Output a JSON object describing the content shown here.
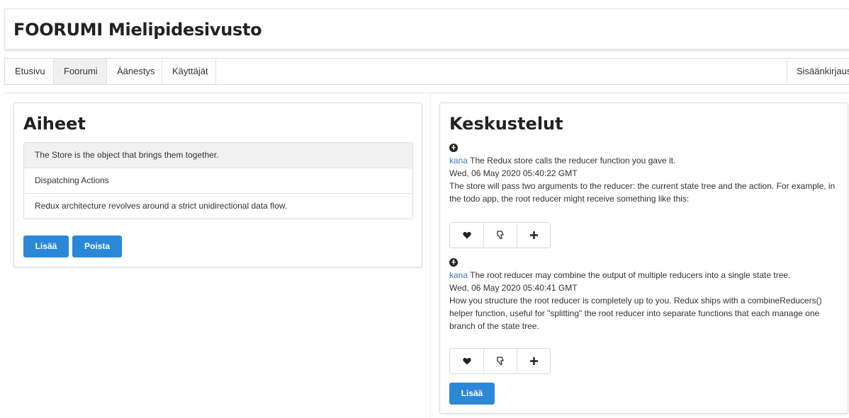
{
  "header": {
    "title": "FOORUMI Mielipidesivusto"
  },
  "nav": {
    "tabs": [
      {
        "label": "Etusivu"
      },
      {
        "label": "Foorumi",
        "active": true
      },
      {
        "label": "Äänestys"
      },
      {
        "label": "Käyttäjät"
      }
    ],
    "login_label": "Sisäänkirjaus"
  },
  "topics": {
    "title": "Aiheet",
    "items": [
      {
        "label": "The Store is the object that brings them together."
      },
      {
        "label": "Dispatching Actions"
      },
      {
        "label": "Redux architecture revolves around a strict unidirectional data flow."
      }
    ],
    "add_label": "Lisää",
    "delete_label": "Poista"
  },
  "discussions": {
    "title": "Keskustelut",
    "posts": [
      {
        "author_icon": "user-circle-icon",
        "author": "kana",
        "subject": " The Redux store calls the reducer function you gave it.",
        "timestamp": "Wed, 06 May 2020 05:40:22 GMT",
        "body_lines": [
          "The store will pass two arguments to the reducer: the current state tree and the action. For example, in",
          "the todo app, the root reducer might receive something like this:"
        ]
      },
      {
        "author_icon": "user-circle-icon",
        "author": "kana",
        "subject": " The root reducer may combine the output of multiple reducers into a single state tree.",
        "timestamp": "Wed, 06 May 2020 05:40:41 GMT",
        "body_lines": [
          "How you structure the root reducer is completely up to you. Redux ships with a combineReducers()",
          "helper function, useful for \"splitting\" the root reducer into separate functions that each manage one",
          "branch of the state tree."
        ]
      }
    ],
    "action_icons": [
      "heart-icon",
      "thumbs-down-icon",
      "plus-icon"
    ],
    "add_label": "Lisää"
  },
  "colors": {
    "primary": "#2b88d8",
    "author_link": "#3d7ab8"
  }
}
